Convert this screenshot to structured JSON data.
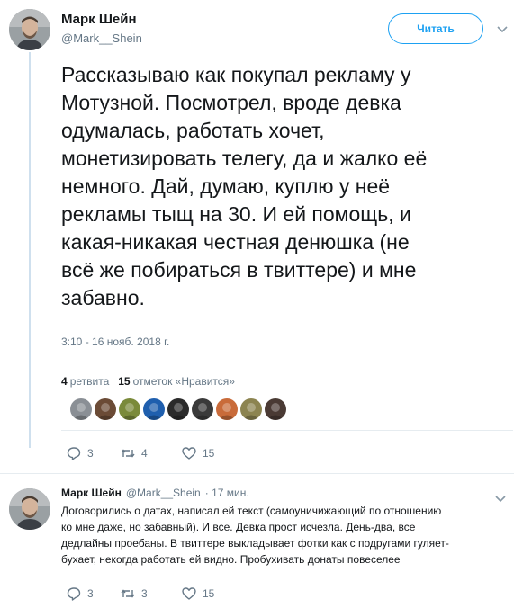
{
  "main_tweet": {
    "author_name": "Марк Шейн",
    "author_handle": "@Mark__Shein",
    "follow_label": "Читать",
    "text": "Рассказываю как покупал рекламу у\nМотузной. Посмотрел, вроде девка\nодумалась, работать хочет,\nмонетизировать телегу, да и жалко её\nнемного. Дай, думаю, куплю у неё\nрекламы тыщ на 30. И ей помощь, и\nкакая-никакая честная денюшка (не\nвсё же побираться в твиттере) и мне\nзабавно.",
    "timestamp": "3:10 - 16 нояб. 2018 г.",
    "retweets_count": "4",
    "retweets_label": "ретвита",
    "likes_count": "15",
    "likes_label": "отметок «Нравится»",
    "actions": {
      "reply_count": "3",
      "retweet_count": "4",
      "like_count": "15"
    }
  },
  "liker_avatars": [
    {
      "name": "liker-1",
      "color": "#8a8f95"
    },
    {
      "name": "liker-2",
      "color": "#6b4b36"
    },
    {
      "name": "liker-3",
      "color": "#7a8a3a"
    },
    {
      "name": "liker-4",
      "color": "#1f5fae"
    },
    {
      "name": "liker-5",
      "color": "#2b2b2b"
    },
    {
      "name": "liker-6",
      "color": "#3a3a3a"
    },
    {
      "name": "liker-7",
      "color": "#c96b3a"
    },
    {
      "name": "liker-8",
      "color": "#8c8450"
    },
    {
      "name": "liker-9",
      "color": "#4a3a34"
    }
  ],
  "reply_tweet": {
    "author_name": "Марк Шейн",
    "author_handle": "@Mark__Shein",
    "time_ago": "· 17 мин.",
    "text": "Договорились о датах, написал ей текст (самоуничижающий по отношению\nко мне даже, но забавный). И все. Девка прост исчезла. День-два, все\nдедлайны проебаны. В твиттере выкладывает фотки как с подругами гуляет-\nбухает, некогда работать ей видно. Пробухивать донаты повеселее",
    "actions": {
      "reply_count": "3",
      "retweet_count": "3",
      "like_count": "15"
    }
  },
  "colors": {
    "accent": "#1da1f2",
    "text": "#14171a",
    "muted": "#657786",
    "thread_line": "#cfe0ee",
    "divider": "#e6ecf0"
  }
}
